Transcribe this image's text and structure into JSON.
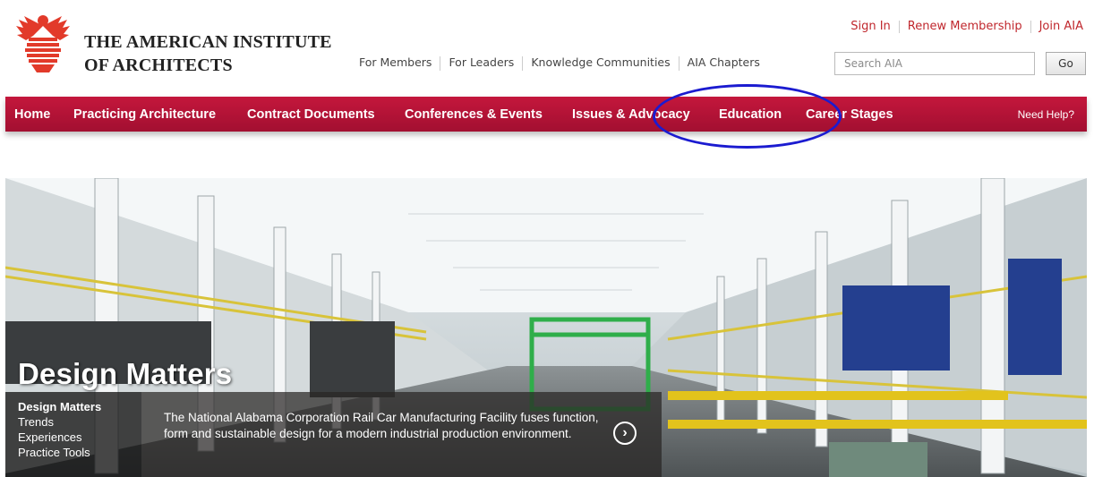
{
  "header": {
    "org_line1": "THE AMERICAN INSTITUTE",
    "org_line2": "OF ARCHITECTS",
    "logo_icon": "aia-eagle-logo",
    "brand_color": "#c4173c"
  },
  "utility_links": [
    "Sign In",
    "Renew Membership",
    "Join AIA"
  ],
  "sub_nav": [
    "For Members",
    "For Leaders",
    "Knowledge Communities",
    "AIA Chapters"
  ],
  "search": {
    "placeholder": "Search AIA",
    "button_label": "Go"
  },
  "main_nav": {
    "items": [
      "Home",
      "Practicing Architecture",
      "Contract Documents",
      "Conferences & Events",
      "Issues & Advocacy",
      "Education",
      "Career Stages"
    ],
    "help_label": "Need Help?"
  },
  "hero": {
    "title": "Design Matters",
    "side_menu": [
      "Design Matters",
      "Trends",
      "Experiences",
      "Practice Tools"
    ],
    "caption": "The National Alabama Corporation Rail Car Manufacturing Facility fuses function, form and sustainable design for a modern industrial production environment.",
    "next_icon": "chevron-right-circle-icon"
  }
}
